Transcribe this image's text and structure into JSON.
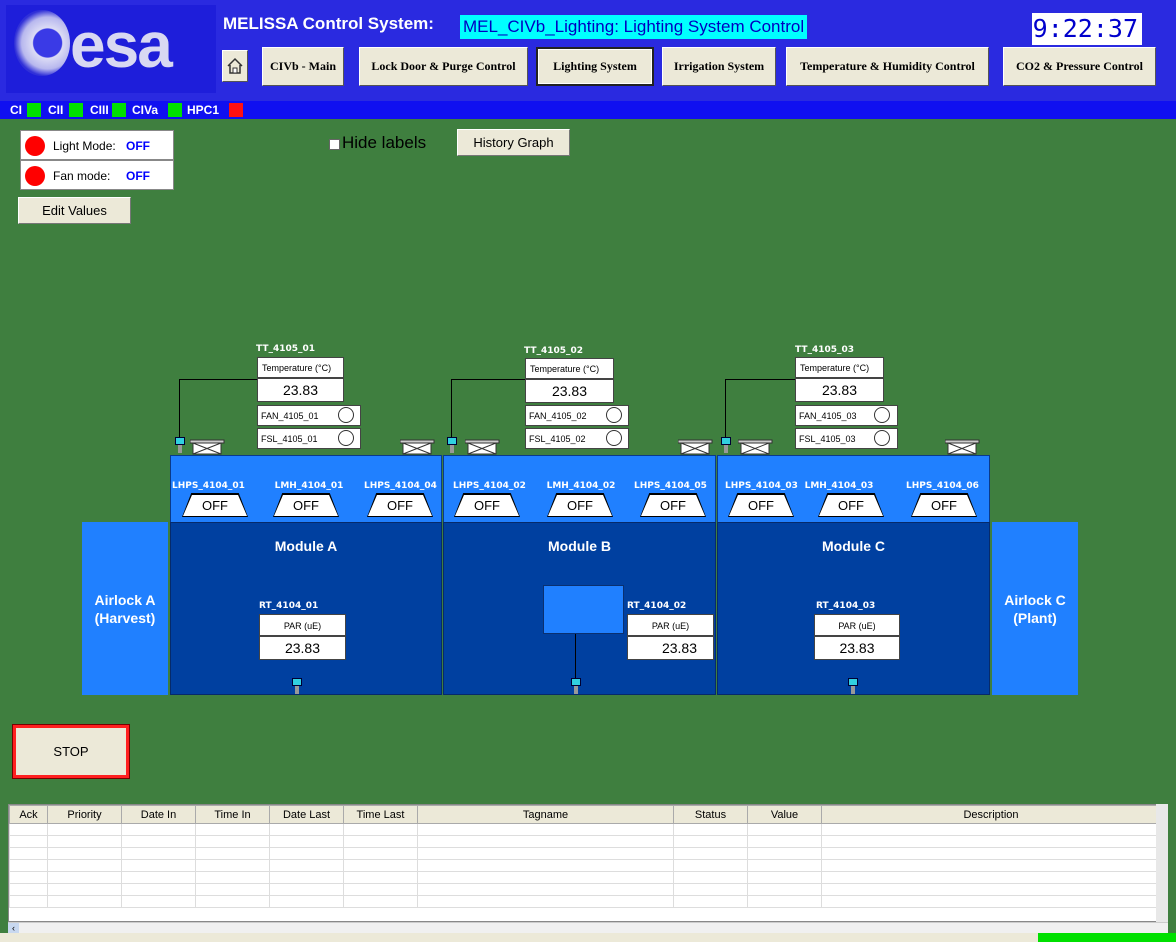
{
  "header": {
    "logo_text": "esa",
    "system_title": "MELISSA Control System:",
    "screen_title": "MEL_CIVb_Lighting: Lighting System Control",
    "clock": "9:22:37"
  },
  "nav": {
    "home_icon": "home-icon",
    "buttons": [
      "CIVb - Main",
      "Lock Door & Purge Control",
      "Lighting System",
      "Irrigation System",
      "Temperature & Humidity Control",
      "CO2 & Pressure Control"
    ],
    "selected": "Lighting System"
  },
  "compartments": [
    {
      "label": "CI",
      "status": "green"
    },
    {
      "label": "CII",
      "status": "green"
    },
    {
      "label": "CIII",
      "status": "green"
    },
    {
      "label": "CIVa",
      "status": "green"
    },
    {
      "label": "HPC1",
      "status": "red"
    }
  ],
  "modes": {
    "light_label": "Light Mode:",
    "light_value": "OFF",
    "fan_label": "Fan mode:",
    "fan_value": "OFF",
    "edit_values": "Edit Values"
  },
  "controls": {
    "hide_labels": "Hide labels",
    "history_graph": "History Graph",
    "stop": "STOP"
  },
  "sensors": {
    "tt": [
      {
        "tag": "TT_4105_01",
        "label": "Temperature (°C)",
        "value": "23.83",
        "fan": "FAN_4105_01",
        "fsl": "FSL_4105_01"
      },
      {
        "tag": "TT_4105_02",
        "label": "Temperature (°C)",
        "value": "23.83",
        "fan": "FAN_4105_02",
        "fsl": "FSL_4105_02"
      },
      {
        "tag": "TT_4105_03",
        "label": "Temperature (°C)",
        "value": "23.83",
        "fan": "FAN_4105_03",
        "fsl": "FSL_4105_03"
      }
    ],
    "rt": [
      {
        "tag": "RT_4104_01",
        "label": "PAR (uE)",
        "value": "23.83"
      },
      {
        "tag": "RT_4104_02",
        "label": "PAR (uE)",
        "value": "23.83"
      },
      {
        "tag": "RT_4104_03",
        "label": "PAR (uE)",
        "value": "23.83"
      }
    ]
  },
  "lamps": [
    {
      "tag": "LHPS_4104_01",
      "state": "OFF"
    },
    {
      "tag": "LMH_4104_01",
      "state": "OFF"
    },
    {
      "tag": "LHPS_4104_04",
      "state": "OFF"
    },
    {
      "tag": "LHPS_4104_02",
      "state": "OFF"
    },
    {
      "tag": "LMH_4104_02",
      "state": "OFF"
    },
    {
      "tag": "LHPS_4104_05",
      "state": "OFF"
    },
    {
      "tag": "LHPS_4104_03",
      "state": "OFF"
    },
    {
      "tag": "LMH_4104_03",
      "state": "OFF"
    },
    {
      "tag": "LHPS_4104_06",
      "state": "OFF"
    }
  ],
  "modules": [
    "Module A",
    "Module B",
    "Module C"
  ],
  "airlocks": {
    "a_line1": "Airlock A",
    "a_line2": "(Harvest)",
    "c_line1": "Airlock C",
    "c_line2": "(Plant)"
  },
  "alarm_table": {
    "columns": [
      "Ack",
      "Priority",
      "Date In",
      "Time In",
      "Date Last",
      "Time Last",
      "Tagname",
      "Status",
      "Value",
      "Description"
    ]
  },
  "colors": {
    "background": "#3f7f3f",
    "header": "#2a2ae0",
    "module": "#0040a0",
    "light_bar": "#2080ff",
    "alarm_red": "#ff0000",
    "ok_green": "#00e000"
  }
}
